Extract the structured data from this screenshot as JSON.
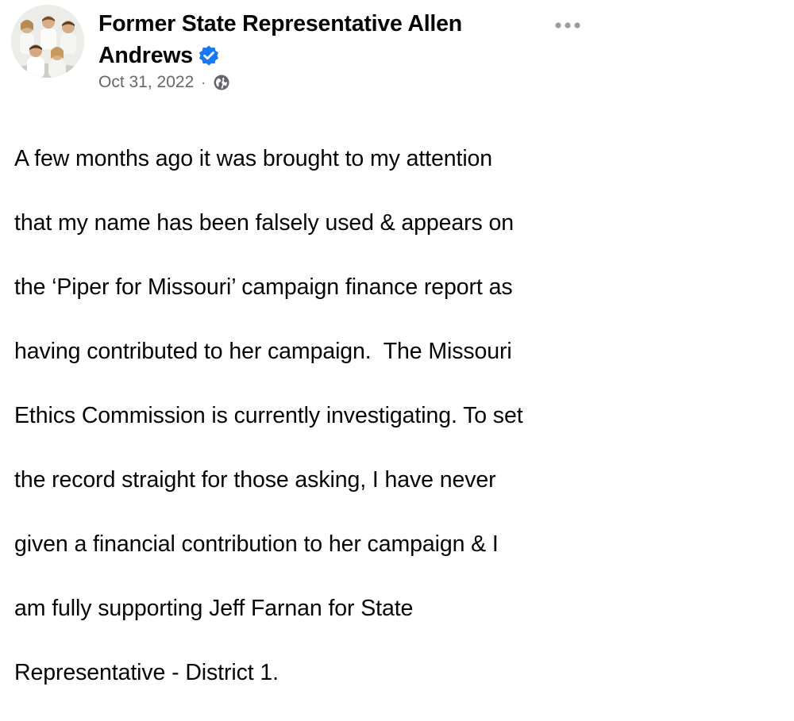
{
  "post": {
    "author": {
      "name": "Former State Representative Allen Andrews",
      "verified": true,
      "verified_color": "#1877f2"
    },
    "date": "Oct 31, 2022",
    "separator": "·",
    "audience_icon": "globe-icon",
    "more_icon": "more-options-icon",
    "text_lines": [
      "A few months ago it was brought to my attention",
      "that my name has been falsely used & appears on",
      "the ‘Piper for Missouri’ campaign finance report as",
      "having contributed to her campaign.  The Missouri",
      "Ethics Commission is currently investigating. To set",
      "the record straight for those asking, I have never",
      "given a financial contribution to her campaign & I",
      "am fully supporting Jeff Farnan for State",
      "Representative - District 1."
    ]
  }
}
